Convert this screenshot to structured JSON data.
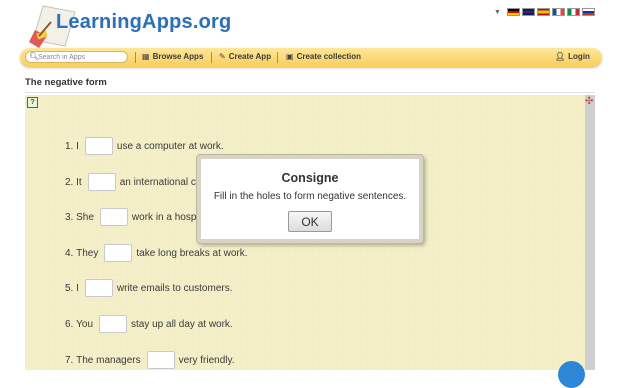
{
  "header": {
    "logo_text": "LearningApps.org",
    "languages": [
      {
        "code": "de",
        "colors": [
          "#000000",
          "#dd0000",
          "#ffce00"
        ]
      },
      {
        "code": "en",
        "colors": [
          "#012169",
          "#ffffff",
          "#c8102e"
        ]
      },
      {
        "code": "es",
        "colors": [
          "#aa151b",
          "#f1bf00",
          "#aa151b"
        ]
      },
      {
        "code": "fr",
        "colors": [
          "#0055a4",
          "#ffffff",
          "#ef4135"
        ]
      },
      {
        "code": "it",
        "colors": [
          "#009246",
          "#ffffff",
          "#ce2b37"
        ]
      },
      {
        "code": "ru",
        "colors": [
          "#ffffff",
          "#0039a6",
          "#d52b1e"
        ]
      }
    ]
  },
  "nav": {
    "search_placeholder": "Search in Apps",
    "browse": "Browse Apps",
    "create": "Create App",
    "collection": "Create collection",
    "login": "Login"
  },
  "page": {
    "title": "The negative form"
  },
  "exercise": {
    "sentences": [
      {
        "num": "1.",
        "before": "I",
        "after": "use a computer at work."
      },
      {
        "num": "2.",
        "before": "It",
        "after": "an international c"
      },
      {
        "num": "3.",
        "before": "She",
        "after": "work in a hosp"
      },
      {
        "num": "4.",
        "before": "They",
        "after": "take long breaks at work."
      },
      {
        "num": "5.",
        "before": "I",
        "after": "write emails to customers."
      },
      {
        "num": "6.",
        "before": "You",
        "after": "stay up all day at work."
      },
      {
        "num": "7.",
        "before": "The managers",
        "after": "very friendly."
      }
    ]
  },
  "modal": {
    "title": "Consigne",
    "text": "Fill in the holes to form negative sentences.",
    "ok": "OK"
  },
  "colors": {
    "accent": "#2f6fb4",
    "nav_bar": "#f7ce5c",
    "exercise_bg": "#f4eec7"
  }
}
